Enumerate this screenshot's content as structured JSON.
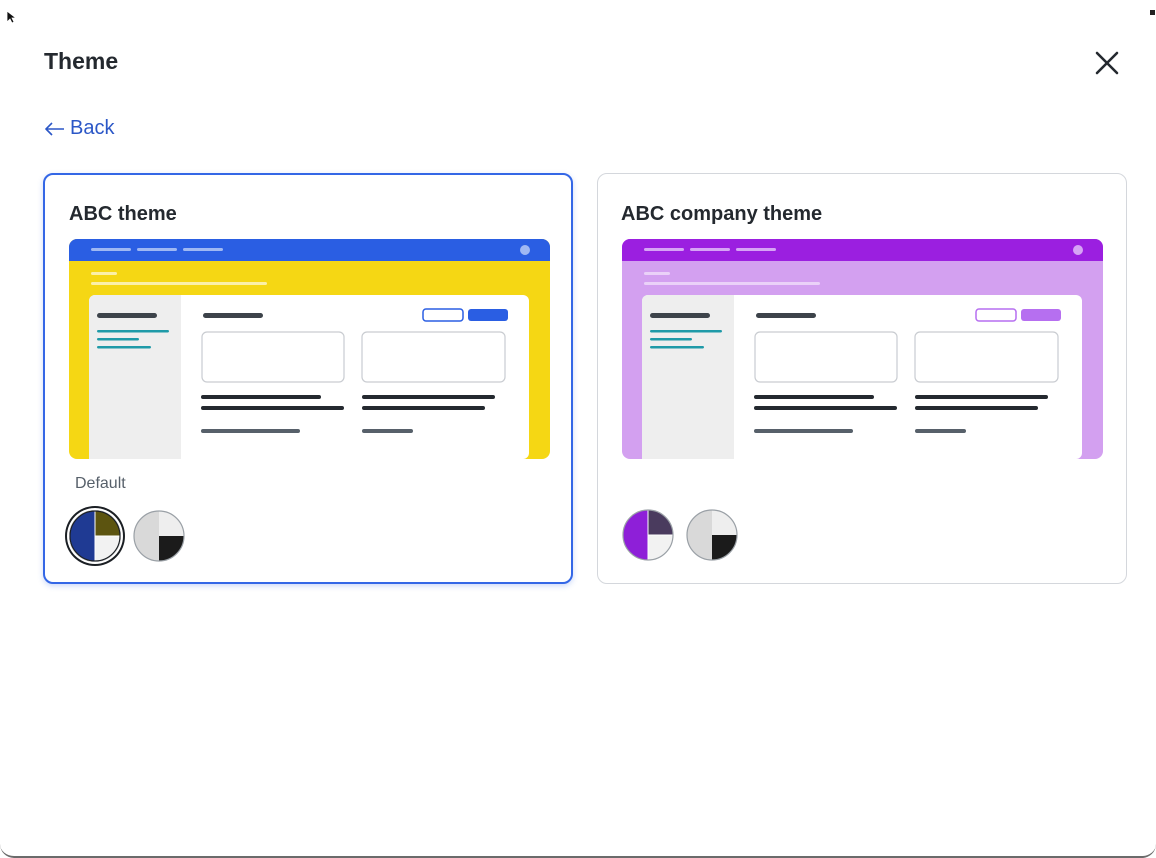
{
  "dialog": {
    "title": "Theme",
    "back_label": "Back",
    "close_icon": "close-icon"
  },
  "themes": [
    {
      "name": "ABC theme",
      "badge": "Default",
      "selected": true,
      "colors": {
        "header": "#2a5ee3",
        "banner": "#f5d714",
        "primary": "#2a5ee3",
        "accent": "#1f9aa8"
      },
      "swatches": [
        {
          "name": "light-mode",
          "selected": true,
          "colors": [
            "#1f3a93",
            "#5c5410",
            "#f2f2f2"
          ]
        },
        {
          "name": "dark-mode",
          "selected": false,
          "colors": [
            "#d9d9d9",
            "#eeeeee",
            "#1b1b1b"
          ]
        }
      ]
    },
    {
      "name": "ABC company theme",
      "selected": false,
      "colors": {
        "header": "#9b1fe0",
        "banner": "#d3a0f0",
        "primary": "#b66ff0",
        "accent": "#1f9aa8"
      },
      "swatches": [
        {
          "name": "light-mode",
          "selected": false,
          "colors": [
            "#8e1fd8",
            "#4a3b5e",
            "#f2f2f2"
          ]
        },
        {
          "name": "dark-mode",
          "selected": false,
          "colors": [
            "#d9d9d9",
            "#eeeeee",
            "#1b1b1b"
          ]
        }
      ]
    }
  ]
}
